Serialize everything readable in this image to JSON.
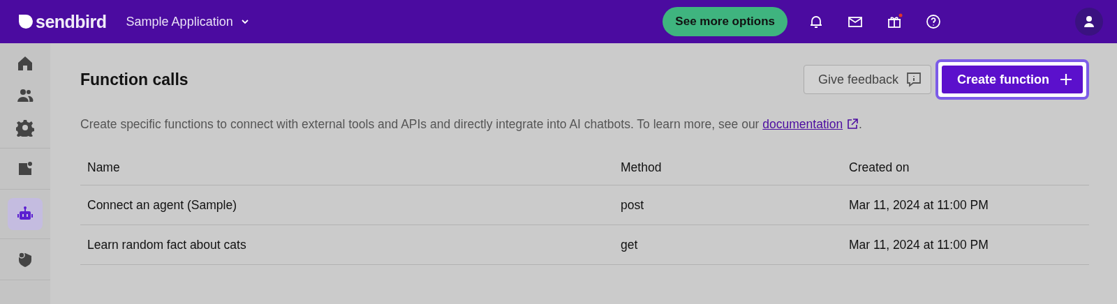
{
  "header": {
    "logo": "sendbird",
    "app_selector": "Sample Application",
    "cta": "See more options",
    "icons": [
      {
        "unread": false
      },
      {
        "unread": false
      },
      {
        "unread": true
      },
      {
        "unread": false
      }
    ]
  },
  "sidebar": {
    "groups": [
      [
        {
          "selected": false
        },
        {
          "selected": false
        },
        {
          "selected": false
        }
      ],
      [
        {
          "selected": false
        }
      ],
      [
        {
          "selected": true
        }
      ],
      [
        {
          "selected": false
        }
      ]
    ]
  },
  "page": {
    "title": "Function calls",
    "feedback_button": "Give feedback",
    "create_button": {
      "label": "Create function",
      "focused": true
    },
    "description": "Create specific functions to connect with external tools and APIs and directly integrate into AI chatbots. To learn more, see our ",
    "link": "documentation",
    "description_end": "."
  },
  "table": {
    "columns": [
      "Name",
      "Method",
      "Created on"
    ],
    "rows": [
      [
        "Connect an agent (Sample)",
        "post",
        "Mar 11, 2024 at 11:00 PM"
      ],
      [
        "Learn random fact about cats",
        "get",
        "Mar 11, 2024 at 11:00 PM"
      ]
    ]
  }
}
